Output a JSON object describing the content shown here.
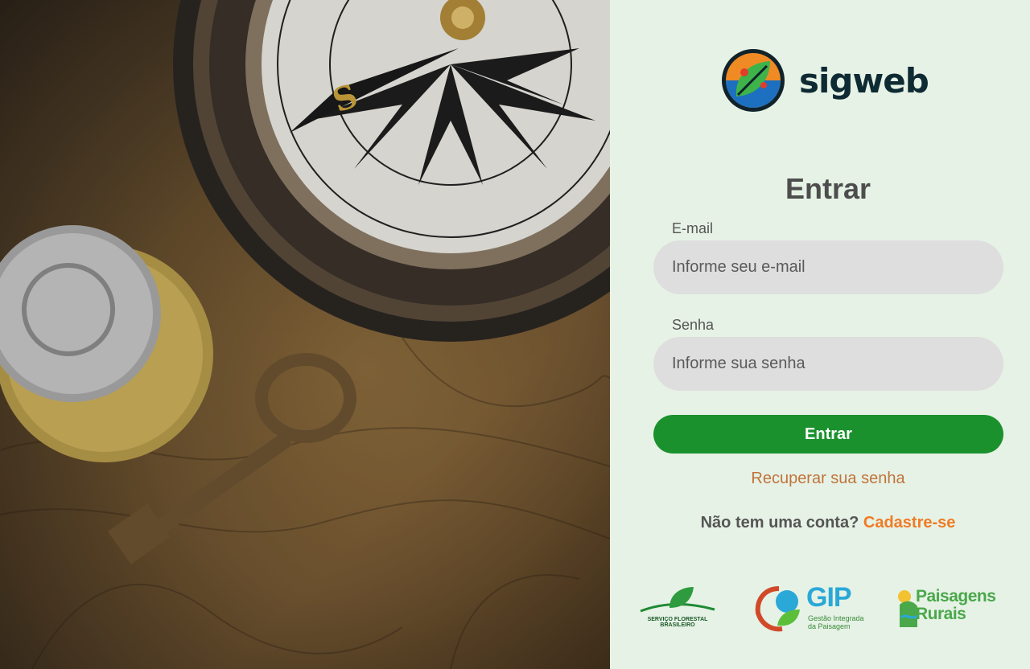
{
  "brand": {
    "name": "sigweb",
    "logo_icon": "sigweb-leaf-logo-icon"
  },
  "form": {
    "title": "Entrar",
    "email_label": "E-mail",
    "email_placeholder": "Informe seu e-mail",
    "password_label": "Senha",
    "password_placeholder": "Informe sua senha",
    "submit_label": "Entrar",
    "recover_label": "Recuperar sua senha",
    "signup_prompt": "Não tem uma conta?",
    "signup_link": "Cadastre-se"
  },
  "partners": {
    "sfb_line1": "SERVIÇO FLORESTAL",
    "sfb_line2": "BRASILEIRO",
    "gip_name": "GIP",
    "gip_line1": "Gestão Integrada",
    "gip_line2": "da Paisagem",
    "pr_line1": "Paisagens",
    "pr_line2": "Rurais"
  },
  "colors": {
    "background": "#e6f2e6",
    "primary_button": "#1a912d",
    "recover_link": "#c0743b",
    "signup_link": "#f07b25",
    "input_bg": "#dedede",
    "brand_text": "#0e2a33"
  }
}
